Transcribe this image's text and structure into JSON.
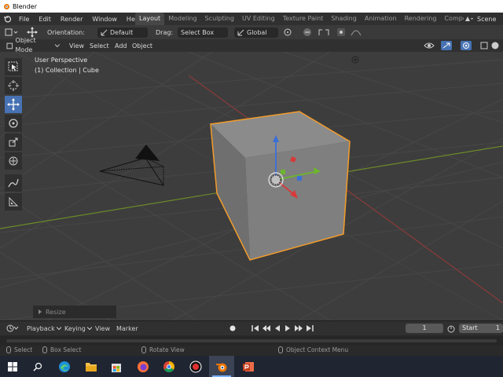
{
  "window": {
    "title": "Blender"
  },
  "menu": {
    "items": [
      "File",
      "Edit",
      "Render",
      "Window",
      "Help"
    ]
  },
  "workspaces": [
    "Layout",
    "Modeling",
    "Sculpting",
    "UV Editing",
    "Texture Paint",
    "Shading",
    "Animation",
    "Rendering",
    "Compo"
  ],
  "active_workspace": "Layout",
  "scene": {
    "label": "Scene"
  },
  "tool_header": {
    "orientation_label": "Orientation:",
    "orientation_value": "Default",
    "drag_label": "Drag:",
    "drag_value": "Select Box",
    "transform_orientation": "Global"
  },
  "viewport_header": {
    "mode": "Object Mode",
    "menus": [
      "View",
      "Select",
      "Add",
      "Object"
    ]
  },
  "viewport": {
    "perspective": "User Perspective",
    "collection": "(1) Collection | Cube"
  },
  "redo_panel": {
    "label": "Resize"
  },
  "timeline": {
    "playback": "Playback",
    "keying": "Keying",
    "view": "View",
    "marker": "Marker",
    "current_frame": "1",
    "start_label": "Start",
    "start_value": "1"
  },
  "status": {
    "select": "Select",
    "box_select": "Box Select",
    "rotate_view": "Rotate View",
    "context_menu": "Object Context Menu"
  },
  "taskbar": {
    "icons": [
      "windows-start-icon",
      "search-icon",
      "edge-icon",
      "file-explorer-icon",
      "store-icon",
      "firefox-icon",
      "chrome-icon",
      "record-icon",
      "blender-icon",
      "powerpoint-icon"
    ]
  },
  "colors": {
    "accent": "#4772b3",
    "selection_outline": "#f39c2b",
    "viewport_bg": "#3d3d3d"
  }
}
